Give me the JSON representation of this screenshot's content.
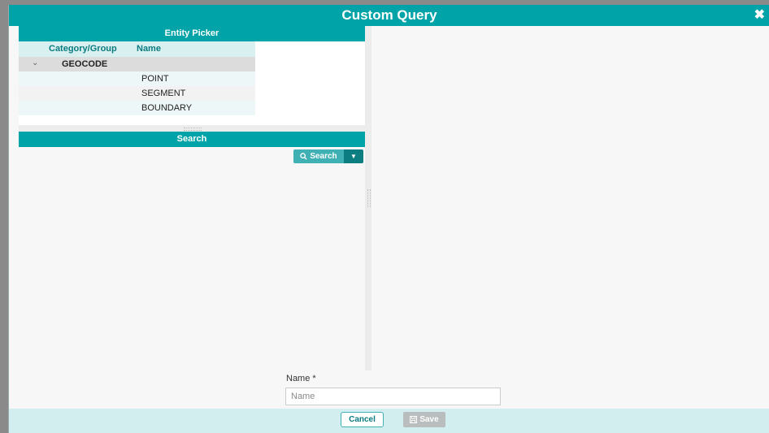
{
  "dialog": {
    "title": "Custom Query",
    "close_icon": "close-icon"
  },
  "entity_picker": {
    "heading": "Entity Picker",
    "columns": [
      "Category/Group",
      "Name"
    ],
    "group": {
      "expander": "chevron-down-icon",
      "label": "GEOCODE"
    },
    "items": [
      "POINT",
      "SEGMENT",
      "BOUNDARY"
    ]
  },
  "search": {
    "heading": "Search",
    "button_label": "Search",
    "button_icon": "search-icon",
    "dropdown_icon": "caret-down-icon"
  },
  "form": {
    "name_label": "Name *",
    "name_placeholder": "Name",
    "name_value": ""
  },
  "footer": {
    "cancel_label": "Cancel",
    "save_label": "Save",
    "save_icon": "floppy-disk-icon"
  },
  "colors": {
    "accent": "#00a3a8",
    "accent_dark": "#0c7d81",
    "footer_bg": "#d2eeee",
    "disabled": "#b9bdbd"
  }
}
